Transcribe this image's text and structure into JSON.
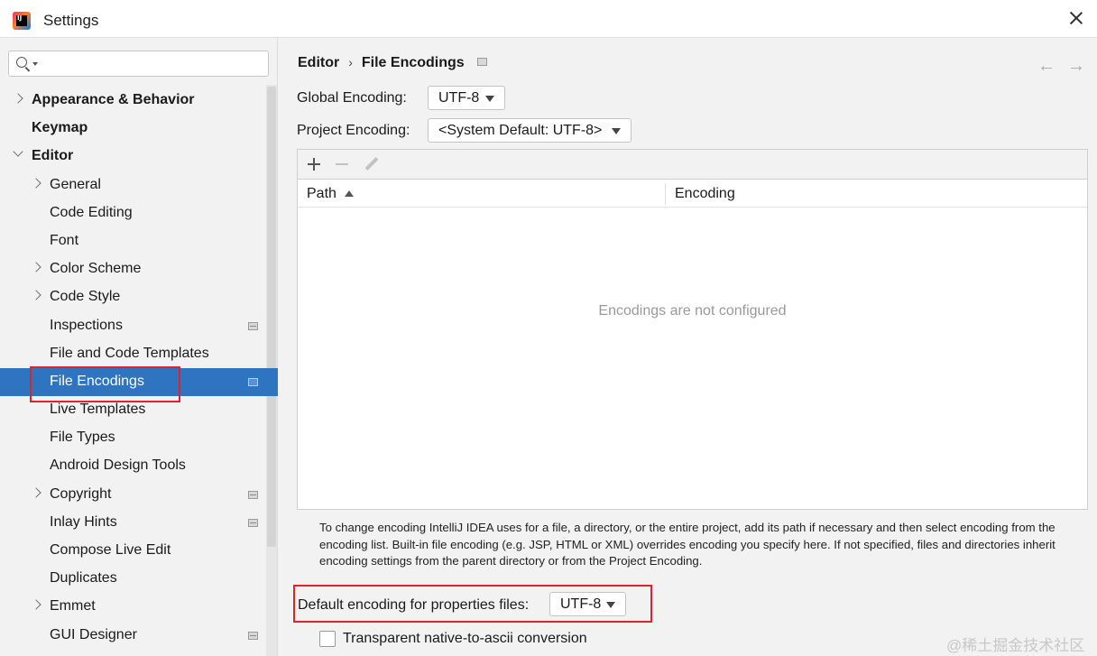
{
  "window": {
    "title": "Settings",
    "logo_text": "IJ",
    "icons": {
      "app": "intellij-logo-icon",
      "close": "close-icon"
    }
  },
  "sidebar": {
    "search": {
      "value": "",
      "placeholder": ""
    },
    "items": [
      {
        "label": "Appearance & Behavior",
        "bold": true,
        "chevron": "right",
        "project_icon": false
      },
      {
        "label": "Keymap",
        "bold": true,
        "chevron": "none",
        "project_icon": false
      },
      {
        "label": "Editor",
        "bold": true,
        "chevron": "down",
        "project_icon": false
      },
      {
        "label": "General",
        "bold": false,
        "chevron": "right",
        "project_icon": false
      },
      {
        "label": "Code Editing",
        "bold": false,
        "chevron": "none",
        "project_icon": false
      },
      {
        "label": "Font",
        "bold": false,
        "chevron": "none",
        "project_icon": false
      },
      {
        "label": "Color Scheme",
        "bold": false,
        "chevron": "right",
        "project_icon": false
      },
      {
        "label": "Code Style",
        "bold": false,
        "chevron": "right",
        "project_icon": false
      },
      {
        "label": "Inspections",
        "bold": false,
        "chevron": "none",
        "project_icon": true
      },
      {
        "label": "File and Code Templates",
        "bold": false,
        "chevron": "none",
        "project_icon": false
      },
      {
        "label": "File Encodings",
        "bold": false,
        "chevron": "none",
        "project_icon": true,
        "selected": true
      },
      {
        "label": "Live Templates",
        "bold": false,
        "chevron": "none",
        "project_icon": false
      },
      {
        "label": "File Types",
        "bold": false,
        "chevron": "none",
        "project_icon": false
      },
      {
        "label": "Android Design Tools",
        "bold": false,
        "chevron": "none",
        "project_icon": false
      },
      {
        "label": "Copyright",
        "bold": false,
        "chevron": "right",
        "project_icon": true
      },
      {
        "label": "Inlay Hints",
        "bold": false,
        "chevron": "none",
        "project_icon": true
      },
      {
        "label": "Compose Live Edit",
        "bold": false,
        "chevron": "none",
        "project_icon": false
      },
      {
        "label": "Duplicates",
        "bold": false,
        "chevron": "none",
        "project_icon": false
      },
      {
        "label": "Emmet",
        "bold": false,
        "chevron": "right",
        "project_icon": false
      },
      {
        "label": "GUI Designer",
        "bold": false,
        "chevron": "none",
        "project_icon": true
      }
    ]
  },
  "main": {
    "breadcrumb": {
      "parent": "Editor",
      "separator": "›",
      "current": "File Encodings"
    },
    "nav": {
      "back": "←",
      "forward": "→"
    },
    "global_encoding": {
      "label": "Global Encoding:",
      "value": "UTF-8"
    },
    "project_encoding": {
      "label": "Project Encoding:",
      "value": "<System Default: UTF-8>"
    },
    "table": {
      "columns": [
        "Path",
        "Encoding"
      ],
      "sort_column": "Path",
      "empty_text": "Encodings are not configured"
    },
    "hint": "To change encoding IntelliJ IDEA uses for a file, a directory, or the entire project, add its path if necessary and then select encoding from the encoding list. Built-in file encoding (e.g. JSP, HTML or XML) overrides encoding you specify here. If not specified, files and directories inherit encoding settings from the parent directory or from the Project Encoding.",
    "properties_encoding": {
      "label": "Default encoding for properties files:",
      "value": "UTF-8"
    },
    "transparent_conversion": {
      "label": "Transparent native-to-ascii conversion",
      "checked": false
    }
  },
  "watermark": "@稀土掘金技术社区",
  "colors": {
    "selection": "#2f74c0",
    "highlight_box": "#e0222c",
    "panel_bg": "#f2f2f2"
  }
}
